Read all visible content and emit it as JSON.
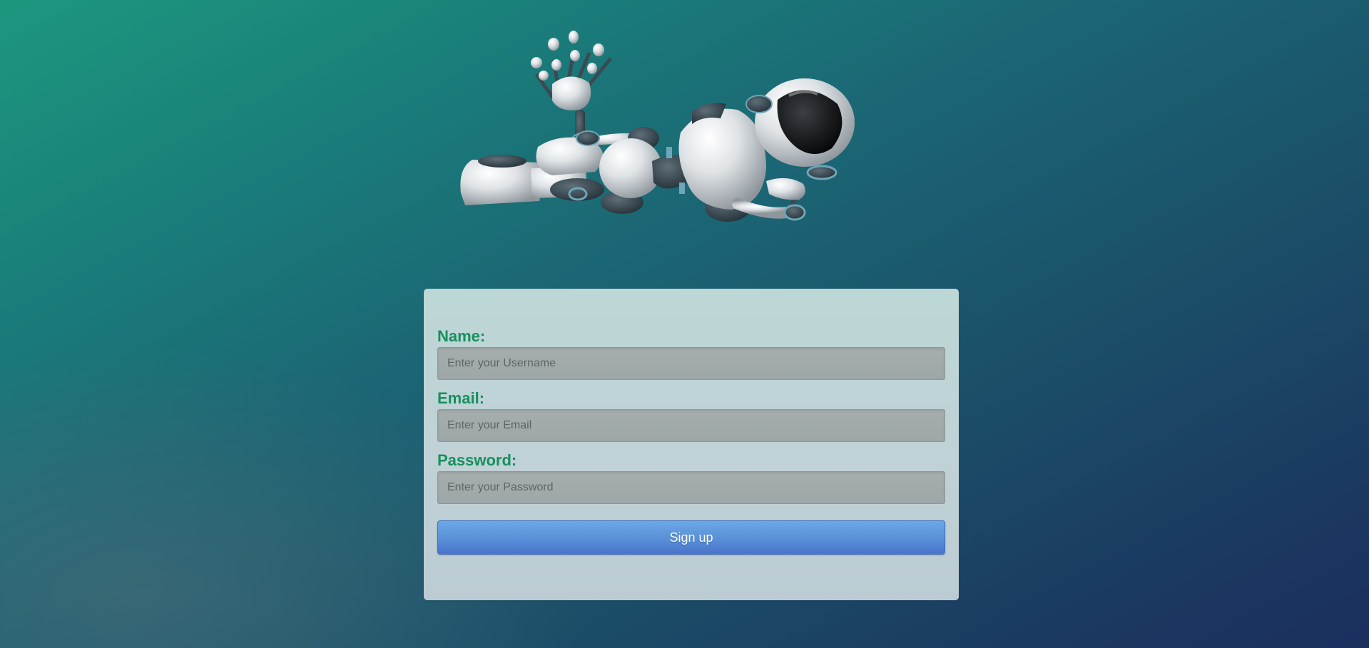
{
  "theme": {
    "label_color": "#16905e",
    "button_color": "#5b92d9",
    "card_color": "#c0d2d6"
  },
  "hero": {
    "icon": "robot-illustration"
  },
  "form": {
    "name": {
      "label": "Name:",
      "placeholder": "Enter your Username",
      "value": ""
    },
    "email": {
      "label": "Email:",
      "placeholder": "Enter your Email",
      "value": ""
    },
    "password": {
      "label": "Password:",
      "placeholder": "Enter your Password",
      "value": ""
    },
    "submit_label": "Sign up"
  }
}
